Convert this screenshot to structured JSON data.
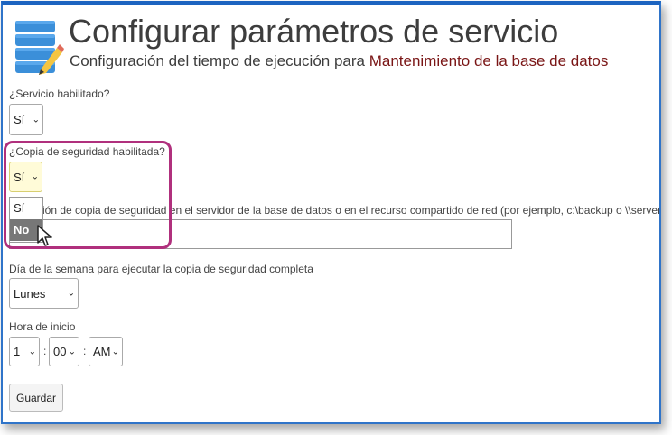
{
  "header": {
    "title": "Configurar parámetros de servicio",
    "subtitle_prefix": "Configuración del tiempo de ejecución para",
    "service_name": "Mantenimiento de la base de datos",
    "icon": "database-pencil-icon"
  },
  "form": {
    "service_enabled": {
      "label": "¿Servicio habilitado?",
      "value": "Sí"
    },
    "backup_enabled": {
      "label": "¿Copia de seguridad habilitada?",
      "value": "Sí",
      "options": [
        "Sí",
        "No"
      ],
      "hovered_option": "No"
    },
    "backup_location": {
      "label_visible": "ión de copia de seguridad en el servidor de la base de datos o en el recurso compartido de red (por ejemplo, c:\\backup o \\\\server",
      "value": ""
    },
    "full_backup_day": {
      "label": "Día de la semana para ejecutar la copia de seguridad completa",
      "value": "Lunes"
    },
    "start_time": {
      "label": "Hora de inicio",
      "hour": "1",
      "minute": "00",
      "ampm": "AM",
      "separator": ":"
    },
    "save_label": "Guardar"
  },
  "colors": {
    "frame_border": "#1c64c0",
    "service_name": "#7a1616",
    "callout": "#b0307d",
    "highlight": "#fffbd8"
  }
}
